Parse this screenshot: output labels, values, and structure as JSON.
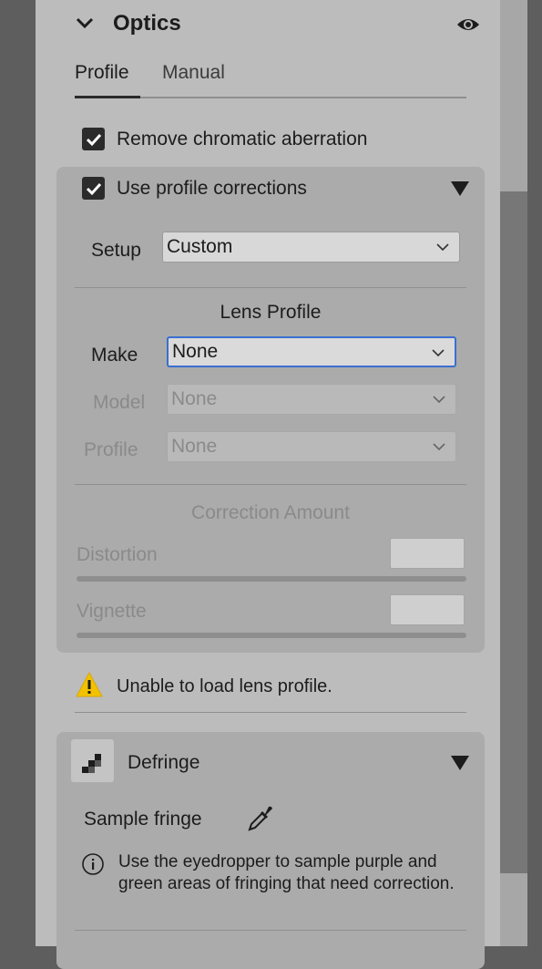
{
  "header": {
    "title": "Optics"
  },
  "tabs": [
    {
      "label": "Profile",
      "active": true
    },
    {
      "label": "Manual",
      "active": false
    }
  ],
  "options": {
    "remove_ca": {
      "label": "Remove chromatic aberration",
      "checked": true
    },
    "use_profile": {
      "label": "Use profile corrections",
      "checked": true
    }
  },
  "setup": {
    "label": "Setup",
    "value": "Custom"
  },
  "lens_profile": {
    "heading": "Lens Profile",
    "make": {
      "label": "Make",
      "value": "None"
    },
    "model": {
      "label": "Model",
      "value": "None"
    },
    "profile": {
      "label": "Profile",
      "value": "None"
    }
  },
  "correction": {
    "heading": "Correction Amount",
    "distortion": {
      "label": "Distortion"
    },
    "vignette": {
      "label": "Vignette"
    }
  },
  "warning": {
    "text": "Unable to load lens profile."
  },
  "defringe": {
    "title": "Defringe",
    "sample_label": "Sample fringe",
    "info": "Use the eyedropper to sample purple and green areas of fringing that need correction."
  },
  "colors": {
    "panel": "#bcbcbc",
    "section": "#ababab",
    "focus": "#3a6fd0",
    "warning": "#f2c200"
  }
}
